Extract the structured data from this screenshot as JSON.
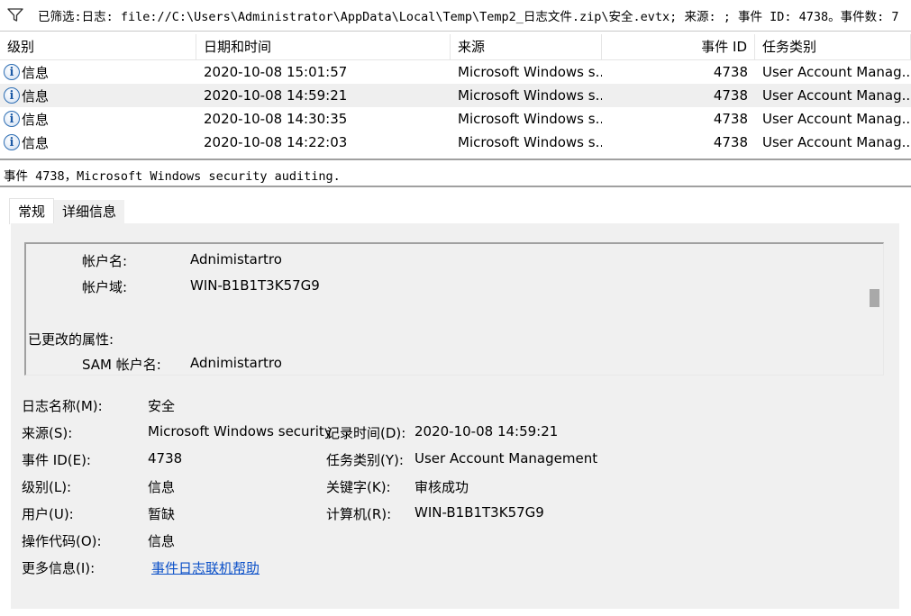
{
  "filter_bar": {
    "icon": "funnel-icon",
    "text": "已筛选:日志: file://C:\\Users\\Administrator\\AppData\\Local\\Temp\\Temp2_日志文件.zip\\安全.evtx; 来源: ; 事件 ID: 4738。事件数: 7"
  },
  "event_list": {
    "columns": [
      "级别",
      "日期和时间",
      "来源",
      "事件 ID",
      "任务类别"
    ],
    "rows": [
      {
        "level": "信息",
        "datetime": "2020-10-08 15:01:57",
        "source": "Microsoft Windows s...",
        "event_id": "4738",
        "task": "User Account Manag..."
      },
      {
        "level": "信息",
        "datetime": "2020-10-08 14:59:21",
        "source": "Microsoft Windows s...",
        "event_id": "4738",
        "task": "User Account Manag..."
      },
      {
        "level": "信息",
        "datetime": "2020-10-08 14:30:35",
        "source": "Microsoft Windows s...",
        "event_id": "4738",
        "task": "User Account Manag..."
      },
      {
        "level": "信息",
        "datetime": "2020-10-08 14:22:03",
        "source": "Microsoft Windows s...",
        "event_id": "4738",
        "task": "User Account Manag..."
      }
    ]
  },
  "event_title": "事件 4738，Microsoft Windows security auditing.",
  "tabs": {
    "general": "常规",
    "details": "详细信息"
  },
  "description": {
    "account_name_label": "帐户名:",
    "account_name_value": "Adnimistartro",
    "account_domain_label": "帐户域:",
    "account_domain_value": "WIN-B1B1T3K57G9",
    "changed_attrs_label": "已更改的属性:",
    "sam_label": "SAM 帐户名:",
    "sam_value": "Adnimistartro"
  },
  "properties": {
    "log_name_label": "日志名称(M):",
    "log_name_value": "安全",
    "source_label": "来源(S):",
    "source_value": "Microsoft Windows security",
    "logged_label": "记录时间(D):",
    "logged_value": "2020-10-08 14:59:21",
    "event_id_label": "事件 ID(E):",
    "event_id_value": "4738",
    "task_label": "任务类别(Y):",
    "task_value": "User Account Management",
    "level_label": "级别(L):",
    "level_value": "信息",
    "keywords_label": "关键字(K):",
    "keywords_value": "审核成功",
    "user_label": "用户(U):",
    "user_value": "暂缺",
    "computer_label": "计算机(R):",
    "computer_value": "WIN-B1B1T3K57G9",
    "opcode_label": "操作代码(O):",
    "opcode_value": "信息",
    "more_info_label": "更多信息(I):",
    "more_info_link": "事件日志联机帮助"
  }
}
